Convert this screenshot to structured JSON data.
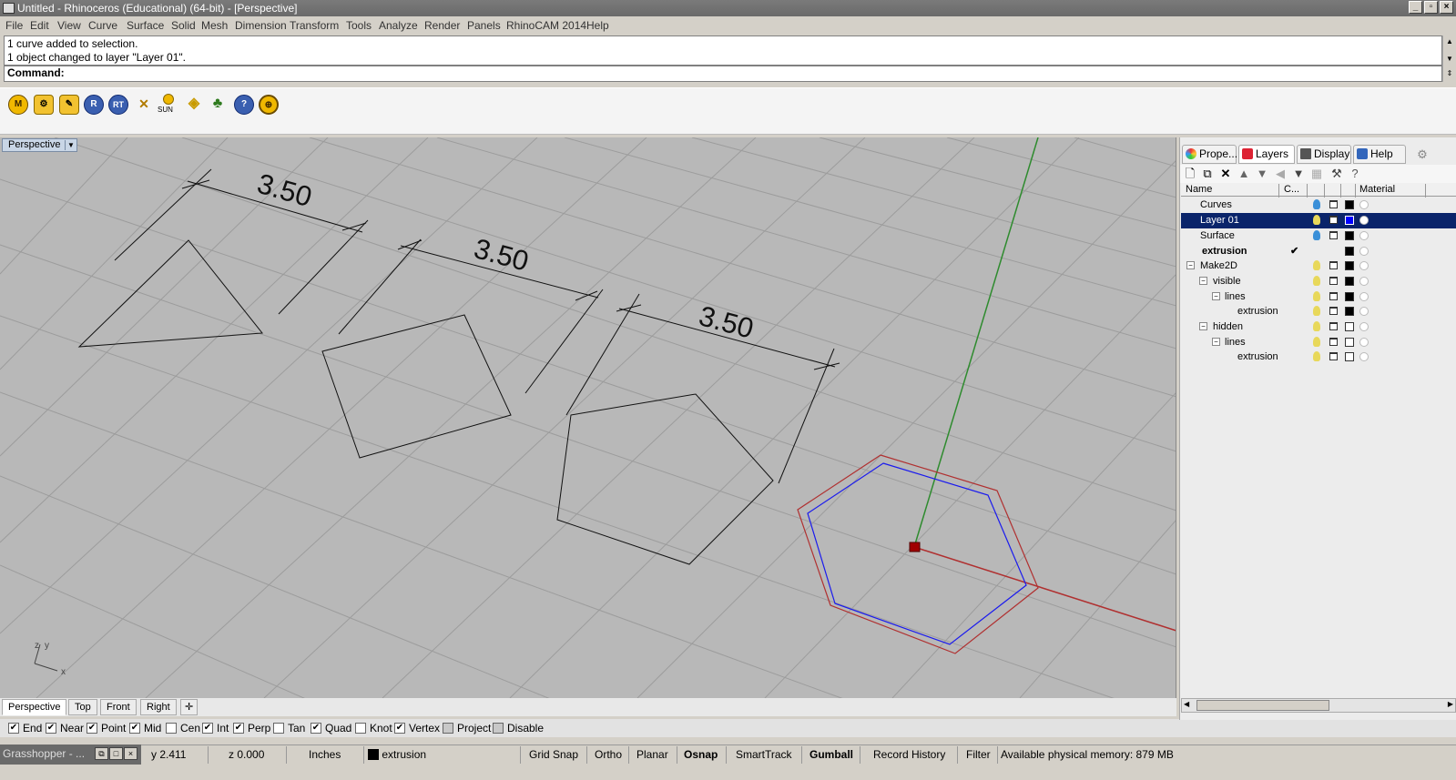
{
  "window": {
    "title": "Untitled - Rhinoceros (Educational) (64-bit) - [Perspective]"
  },
  "menu": [
    "File",
    "Edit",
    "View",
    "Curve",
    "Surface",
    "Solid",
    "Mesh",
    "Dimension",
    "Transform",
    "Tools",
    "Analyze",
    "Render",
    "Panels",
    "RhinoCAM 2014",
    "Help"
  ],
  "history": [
    "1 curve added to selection.",
    "1 object changed to layer \"Layer 01\"."
  ],
  "command": {
    "label": "Command:"
  },
  "toolbar": {
    "sun_label": "SUN",
    "icons": [
      "m-icon",
      "render-settings-icon",
      "render-preview-icon",
      "r-icon",
      "rt-icon",
      "ground-plane-icon",
      "sun-icon",
      "light-icon",
      "tree-plugin-icon",
      "help-icon",
      "target-icon"
    ]
  },
  "viewport": {
    "name": "Perspective",
    "dimensions": [
      "3.50",
      "3.50",
      "3.50"
    ],
    "axis_labels": {
      "z": "z",
      "y": "y",
      "x": "x"
    }
  },
  "viewport_tabs": [
    "Perspective",
    "Top",
    "Front",
    "Right"
  ],
  "osnap": [
    {
      "label": "End",
      "checked": true
    },
    {
      "label": "Near",
      "checked": true
    },
    {
      "label": "Point",
      "checked": true
    },
    {
      "label": "Mid",
      "checked": true
    },
    {
      "label": "Cen",
      "checked": false
    },
    {
      "label": "Int",
      "checked": true
    },
    {
      "label": "Perp",
      "checked": true
    },
    {
      "label": "Tan",
      "checked": false
    },
    {
      "label": "Quad",
      "checked": true
    },
    {
      "label": "Knot",
      "checked": false
    },
    {
      "label": "Vertex",
      "checked": true
    },
    {
      "label": "Project",
      "checked": false
    },
    {
      "label": "Disable",
      "checked": false
    }
  ],
  "statusbar": {
    "grasshopper": "Grasshopper - ...",
    "y": "y 2.411",
    "z": "z 0.000",
    "units": "Inches",
    "layer": "extrusion",
    "modes": [
      "Grid Snap",
      "Ortho",
      "Planar",
      "Osnap",
      "SmartTrack",
      "Gumball",
      "Record History",
      "Filter"
    ],
    "memory": "Available physical memory: 879 MB"
  },
  "panel": {
    "tabs": [
      "Prope...",
      "Layers",
      "Display",
      "Help"
    ],
    "columns": {
      "name": "Name",
      "current": "C...",
      "material": "Material"
    },
    "layers": [
      {
        "name": "Curves",
        "indent": 0,
        "bulb": "#3a8fd8",
        "swatch": "#000000"
      },
      {
        "name": "Layer 01",
        "indent": 0,
        "bulb": "#e8d85a",
        "swatch": "#0000ff",
        "selected": true
      },
      {
        "name": "Surface",
        "indent": 0,
        "bulb": "#3a8fd8",
        "swatch": "#000000"
      },
      {
        "name": "extrusion",
        "indent": 0,
        "current": "✔",
        "swatch": "#000000",
        "bold": true
      },
      {
        "name": "Make2D",
        "indent": 0,
        "bulb": "#e8d85a",
        "swatch": "#000000",
        "expand": "⊟"
      },
      {
        "name": "visible",
        "indent": 1,
        "bulb": "#e8d85a",
        "swatch": "#000000",
        "expand": "⊟"
      },
      {
        "name": "lines",
        "indent": 2,
        "bulb": "#e8d85a",
        "swatch": "#000000",
        "expand": "⊟"
      },
      {
        "name": "extrusion",
        "indent": 3,
        "bulb": "#e8d85a",
        "swatch": "#000000"
      },
      {
        "name": "hidden",
        "indent": 1,
        "bulb": "#e8d85a",
        "swatch": "#ffffff",
        "expand": "⊟"
      },
      {
        "name": "lines",
        "indent": 2,
        "bulb": "#e8d85a",
        "swatch": "#ffffff",
        "expand": "⊟"
      },
      {
        "name": "extrusion",
        "indent": 3,
        "bulb": "#e8d85a",
        "swatch": "#ffffff"
      }
    ]
  }
}
